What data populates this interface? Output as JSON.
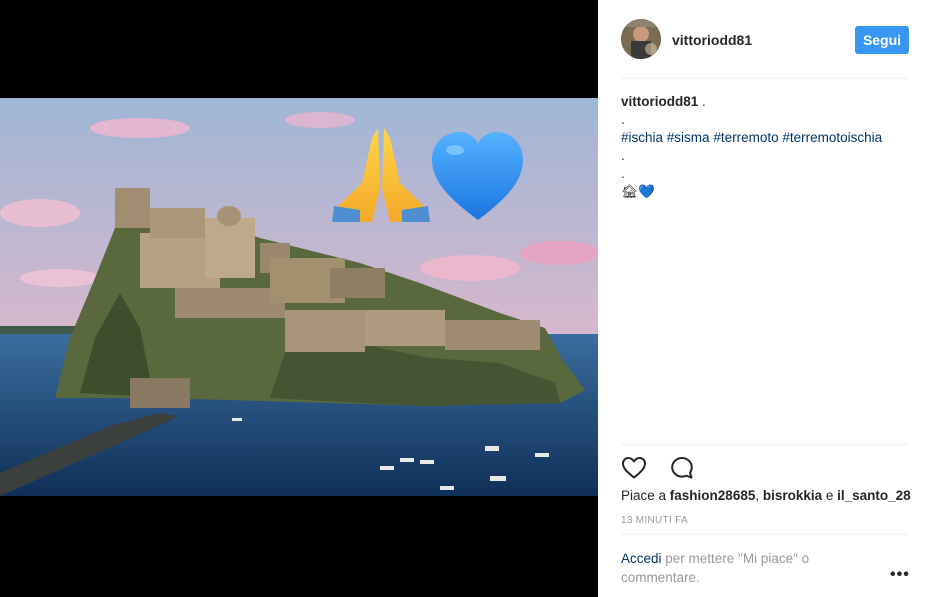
{
  "post": {
    "header": {
      "username": "vittoriodd81",
      "follow_label": "Segui"
    },
    "caption": {
      "username": "vittoriodd81",
      "text": " .",
      "lines": [
        ".",
        ".",
        "."
      ],
      "hashtags": [
        "#ischia",
        "#sisma",
        "#terremoto",
        "#terremotoischia"
      ],
      "emoji": "🏚💙"
    },
    "image": {
      "overlay_emoji": [
        "praying-hands",
        "blue-heart"
      ]
    },
    "actions": {
      "like_icon": "heart-icon",
      "comment_icon": "comment-icon"
    },
    "likes": {
      "prefix": "Piace a",
      "users": [
        "fashion28685",
        "bisrokkia",
        "il_santo_28"
      ],
      "separators": [
        ", ",
        " e "
      ]
    },
    "time": "13 MINUTI FA",
    "login_prompt": {
      "link": "Accedi",
      "text": " per mettere \"Mi piace\" o commentare."
    },
    "more_icon": "more-options-icon"
  },
  "colors": {
    "follow_button": "#3897f0",
    "link": "#003569",
    "muted": "#999999",
    "media_background": "#000000"
  }
}
